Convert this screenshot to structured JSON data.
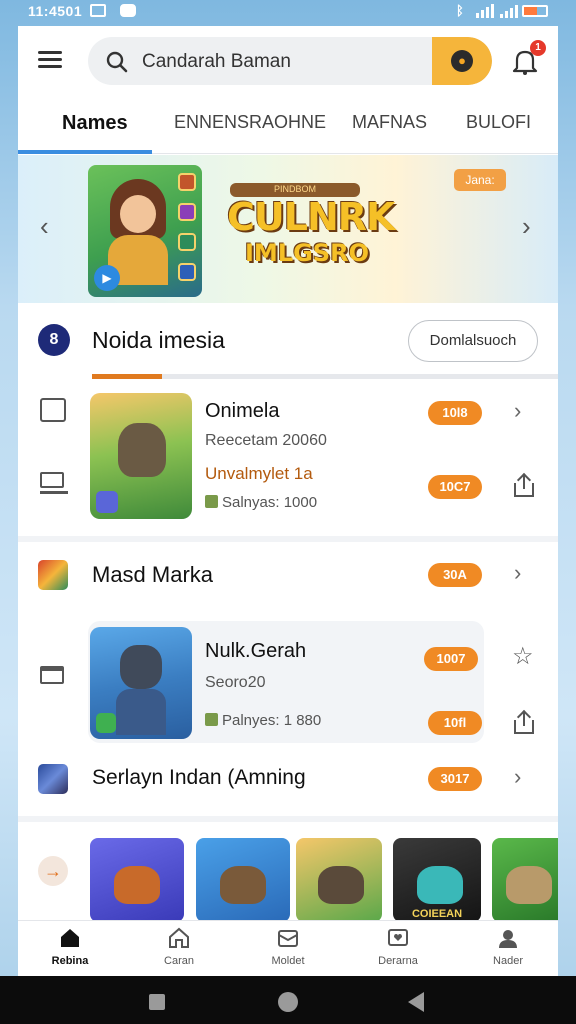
{
  "status_bar": {
    "time": "11:4501"
  },
  "search": {
    "query": "Candarah Baman"
  },
  "notifications": {
    "badge": "1"
  },
  "tabs": [
    {
      "label": "Names",
      "active": true
    },
    {
      "label": "ENNENSRAOHNE",
      "active": false
    },
    {
      "label": "MAFNAS",
      "active": false
    },
    {
      "label": "BULOFI",
      "active": false
    }
  ],
  "banner": {
    "logo_top": "PINDBOM",
    "logo_line1": "CULNRK",
    "logo_line2": "IMLGSRO",
    "pill": "Jana:",
    "prev_arrow": "‹",
    "next_arrow": "›"
  },
  "section1": {
    "icon_glyph": "8",
    "title": "Noida imesia",
    "button": "Domlalsuoch",
    "progress": 0.15
  },
  "games": [
    {
      "title": "Onimela",
      "subtitle": "Reecetam 20060",
      "developer": "Unvalmylet 1a",
      "meta": "Salnyas: 1000",
      "badge_top": "10l8",
      "badge_bottom": "10C7"
    },
    {
      "title": "Nulk.Gerah",
      "subtitle": "Seoro20",
      "meta": "Palnyes: 1 880",
      "badge_top": "1007",
      "badge_bottom": "10fl"
    }
  ],
  "rows": [
    {
      "title": "Masd Marka",
      "badge": "30A"
    },
    {
      "title": "Serlayn Indan (Amning",
      "badge": "3017"
    }
  ],
  "carousel": {
    "arrow": "→",
    "tiles": [
      {
        "label": ""
      },
      {
        "label": ""
      },
      {
        "label": ""
      },
      {
        "label": "COIEEAN"
      },
      {
        "label": ""
      }
    ]
  },
  "bottom_nav": [
    {
      "label": "Rebina",
      "icon": "home-icon",
      "active": true
    },
    {
      "label": "Caran",
      "icon": "house-outline-icon",
      "active": false
    },
    {
      "label": "Moldet",
      "icon": "mail-icon",
      "active": false
    },
    {
      "label": "Derarna",
      "icon": "message-heart-icon",
      "active": false
    },
    {
      "label": "Nader",
      "icon": "profile-icon",
      "active": false
    }
  ],
  "colors": {
    "accent_orange": "#f08a24",
    "tab_underline": "#3a8de0",
    "search_button": "#f5b53b"
  }
}
